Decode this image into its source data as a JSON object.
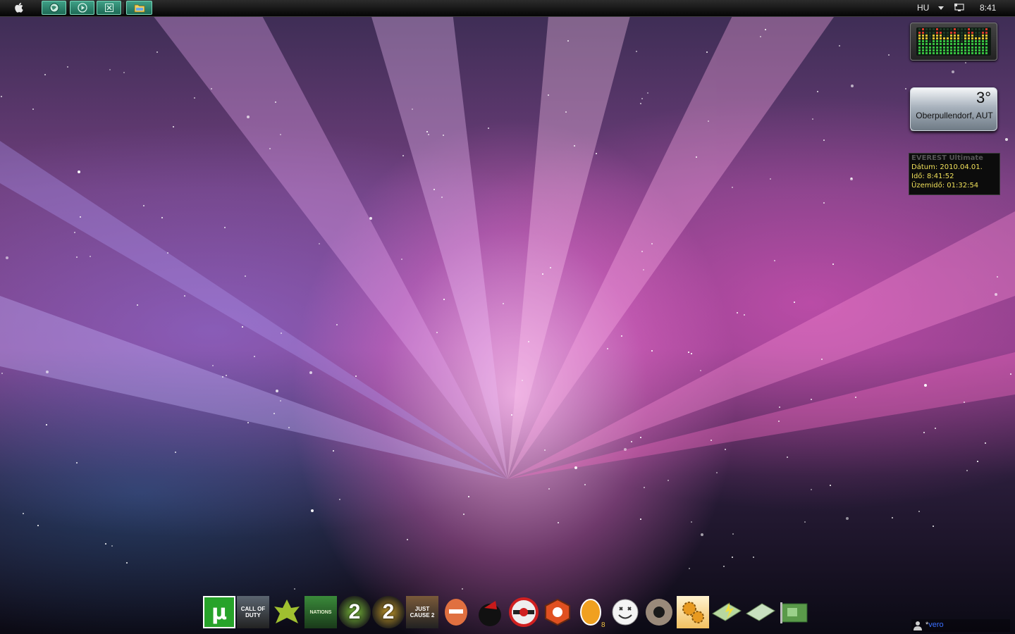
{
  "top_bar": {
    "apple_menu_icon": "apple-icon",
    "quick_launch": [
      {
        "name": "globe-icon"
      },
      {
        "name": "media-player-icon"
      },
      {
        "name": "excel-icon"
      }
    ],
    "taskbar_item_icon": "explorer-folder-icon",
    "language": "HU",
    "clock": "8:41"
  },
  "gadgets": {
    "cpu_meter": {
      "icon": "audio-meter"
    },
    "weather": {
      "temperature": "3°",
      "location": "Oberpullendorf, AUT"
    },
    "everest": {
      "title": "EVEREST Ultimate",
      "date_line": "Dátum: 2010.04.01.",
      "time_line": "Idő: 8:41:52",
      "uptime_line": "Üzemidő: 01:32:54"
    }
  },
  "dock": {
    "items": [
      {
        "name": "utorrent-icon",
        "label": "µ",
        "color": "#27a32a"
      },
      {
        "name": "call-of-duty-icon",
        "label": "CALL OF DUTY",
        "color": "#5b6570"
      },
      {
        "name": "crysis-icon",
        "label": "",
        "color": "#a0c030"
      },
      {
        "name": "trackmania-icon",
        "label": "NATIONS",
        "color": "#2f6b2f"
      },
      {
        "name": "mw2-icon",
        "label": "2",
        "color": "#7bbf3a"
      },
      {
        "name": "mw2-gold-icon",
        "label": "2",
        "color": "#c49a2a"
      },
      {
        "name": "just-cause-2-icon",
        "label": "JUST CAUSE 2",
        "color": "#7a5a3a"
      },
      {
        "name": "bomberman-icon",
        "label": "",
        "color": "#e07040"
      },
      {
        "name": "vinyl-record-icon",
        "label": "",
        "color": "#c81a1a"
      },
      {
        "name": "traktor-icon",
        "label": "",
        "color": "#d02020"
      },
      {
        "name": "reason-icon",
        "label": "",
        "color": "#e05020"
      },
      {
        "name": "fl-studio-icon",
        "label": "8",
        "color": "#f0a020"
      },
      {
        "name": "smiley-icon",
        "label": "",
        "color": "#eeeeee"
      },
      {
        "name": "ring-icon",
        "label": "",
        "color": "#8a6a4a"
      },
      {
        "name": "gears-icon",
        "label": "",
        "color": "#e89a20"
      },
      {
        "name": "memory-card-icon",
        "label": "",
        "color": "#b8d8a0"
      },
      {
        "name": "ram-chip-icon",
        "label": "",
        "color": "#c8e0c0"
      },
      {
        "name": "network-card-icon",
        "label": "",
        "color": "#5a9a4a"
      }
    ]
  },
  "user_tray": {
    "star": "*",
    "name": "vero"
  }
}
